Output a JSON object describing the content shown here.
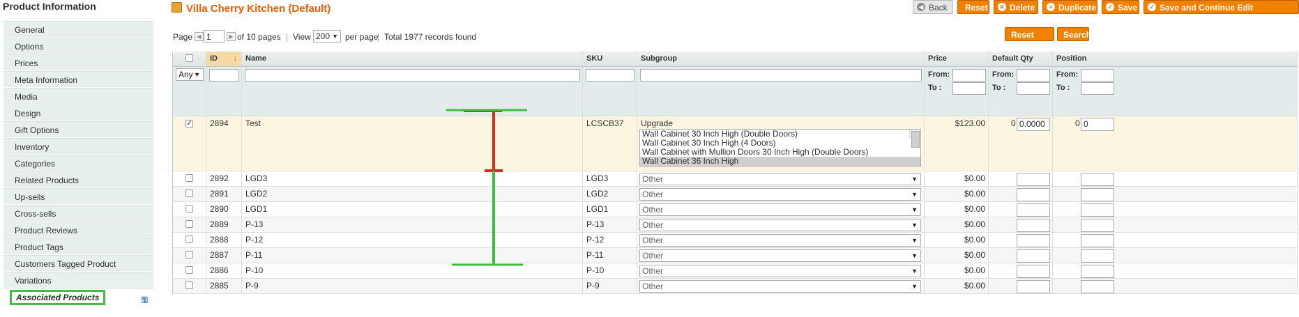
{
  "sidebar": {
    "title": "Product Information",
    "items": [
      {
        "label": "General"
      },
      {
        "label": "Options"
      },
      {
        "label": "Prices"
      },
      {
        "label": "Meta Information"
      },
      {
        "label": "Media"
      },
      {
        "label": "Design"
      },
      {
        "label": "Gift Options"
      },
      {
        "label": "Inventory"
      },
      {
        "label": "Categories"
      },
      {
        "label": "Related Products"
      },
      {
        "label": "Up-sells"
      },
      {
        "label": "Cross-sells"
      },
      {
        "label": "Product Reviews"
      },
      {
        "label": "Product Tags"
      },
      {
        "label": "Customers Tagged Product"
      },
      {
        "label": "Variations"
      }
    ],
    "active_item": {
      "label": "Associated Products"
    }
  },
  "header": {
    "title": "Villa Cherry Kitchen (Default)",
    "back": "Back",
    "reset": "Reset",
    "delete": "Delete",
    "duplicate": "Duplicate",
    "save": "Save",
    "save_continue": "Save and Continue Edit"
  },
  "pager": {
    "page_label": "Page",
    "page_value": "1",
    "of_pages": "of 10 pages",
    "view_label": "View",
    "view_value": "200",
    "per_page": "per page",
    "records": "Total 1977 records found",
    "reset_filter": "Reset Filter",
    "search": "Search"
  },
  "grid": {
    "columns": {
      "id": "ID",
      "name": "Name",
      "sku": "SKU",
      "subgroup": "Subgroup",
      "price": "Price",
      "default_qty": "Default Qty",
      "position": "Position"
    },
    "filter": {
      "any": "Any",
      "from": "From:",
      "to": "To :"
    },
    "selected_row": {
      "id": "2894",
      "name": "Test",
      "sku": "LCSCB37",
      "subgroup": "Upgrade",
      "options": [
        "Wall Cabinet 30 Inch High (Double Doors)",
        "Wall Cabinet 30 Inch High (4 Doors)",
        "Wall Cabinet with Mullion Doors 30 Inch High (Double Doors)",
        "Wall Cabinet 36 Inch High"
      ],
      "price": "$123.00",
      "qty_num": "0",
      "qty_value": "0.0000",
      "pos_num": "0",
      "pos_value": "0"
    },
    "rows": [
      {
        "id": "2892",
        "name": "LGD3",
        "sku": "LGD3",
        "subgroup": "Other",
        "price": "$0.00"
      },
      {
        "id": "2891",
        "name": "LGD2",
        "sku": "LGD2",
        "subgroup": "Other",
        "price": "$0.00"
      },
      {
        "id": "2890",
        "name": "LGD1",
        "sku": "LGD1",
        "subgroup": "Other",
        "price": "$0.00"
      },
      {
        "id": "2889",
        "name": "P-13",
        "sku": "P-13",
        "subgroup": "Other",
        "price": "$0.00"
      },
      {
        "id": "2888",
        "name": "P-12",
        "sku": "P-12",
        "subgroup": "Other",
        "price": "$0.00"
      },
      {
        "id": "2887",
        "name": "P-11",
        "sku": "P-11",
        "subgroup": "Other",
        "price": "$0.00"
      },
      {
        "id": "2886",
        "name": "P-10",
        "sku": "P-10",
        "subgroup": "Other",
        "price": "$0.00"
      },
      {
        "id": "2885",
        "name": "P-9",
        "sku": "P-9",
        "subgroup": "Other",
        "price": "$0.00"
      }
    ]
  },
  "colors": {
    "accent": "#f18200",
    "title": "#eb5e00",
    "annotation_red": "#c8321e",
    "annotation_green": "#3fbf3f"
  }
}
